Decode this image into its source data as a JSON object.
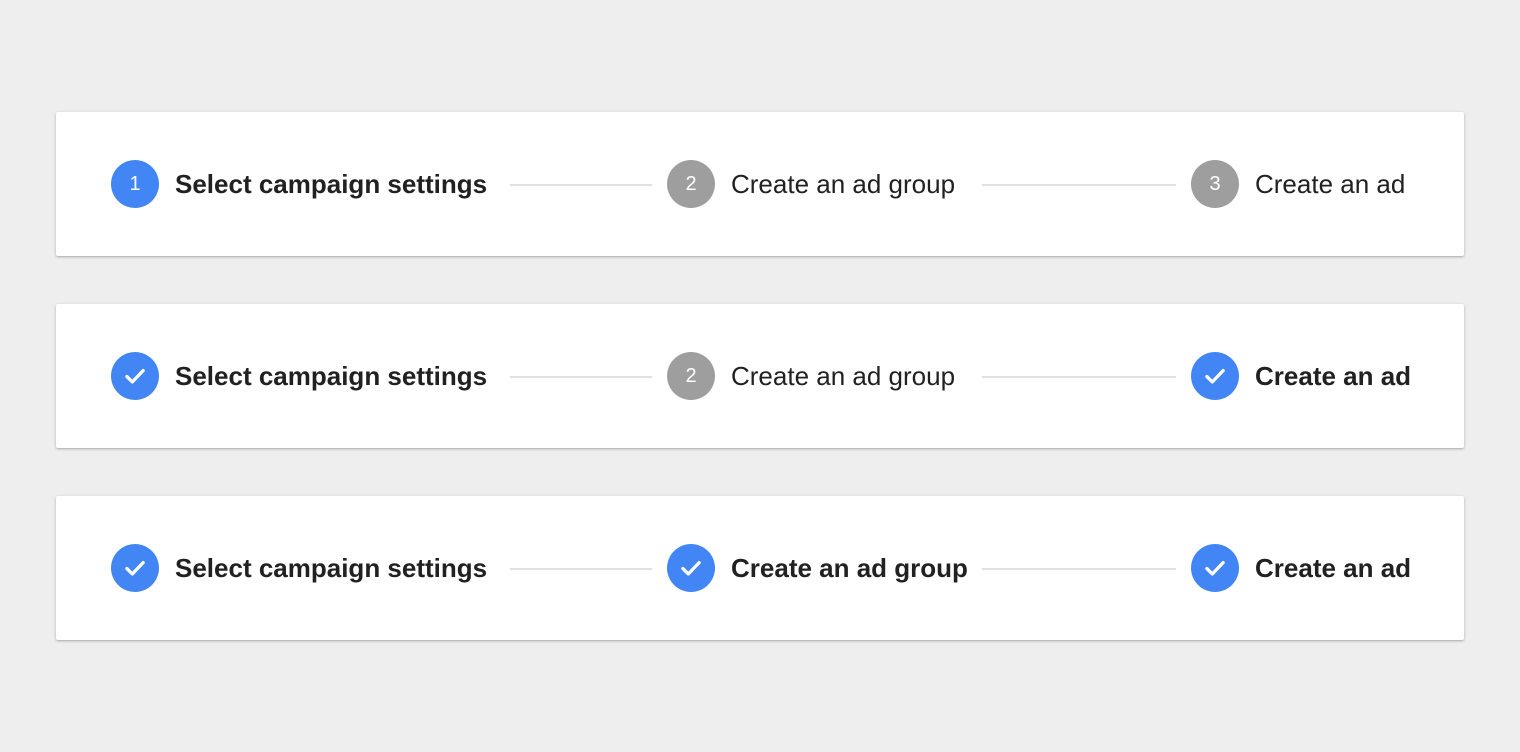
{
  "colors": {
    "background": "#eeeeee",
    "card": "#ffffff",
    "active_blue": "#4285f4",
    "inactive_gray": "#9e9e9e",
    "connector": "#e0e0e0",
    "text": "#212121"
  },
  "steppers": [
    {
      "steps": [
        {
          "number": "1",
          "label": "Select campaign settings",
          "state": "active"
        },
        {
          "number": "2",
          "label": "Create an ad group",
          "state": "inactive"
        },
        {
          "number": "3",
          "label": "Create an ad",
          "state": "inactive"
        }
      ]
    },
    {
      "steps": [
        {
          "number": "",
          "label": "Select campaign settings",
          "state": "completed",
          "icon": "check-icon"
        },
        {
          "number": "2",
          "label": "Create an ad group",
          "state": "inactive"
        },
        {
          "number": "",
          "label": "Create an ad",
          "state": "completed",
          "icon": "check-icon"
        }
      ]
    },
    {
      "steps": [
        {
          "number": "",
          "label": "Select campaign settings",
          "state": "completed",
          "icon": "check-icon"
        },
        {
          "number": "",
          "label": "Create an ad group",
          "state": "completed",
          "icon": "check-icon"
        },
        {
          "number": "",
          "label": "Create an ad",
          "state": "completed",
          "icon": "check-icon"
        }
      ]
    }
  ]
}
